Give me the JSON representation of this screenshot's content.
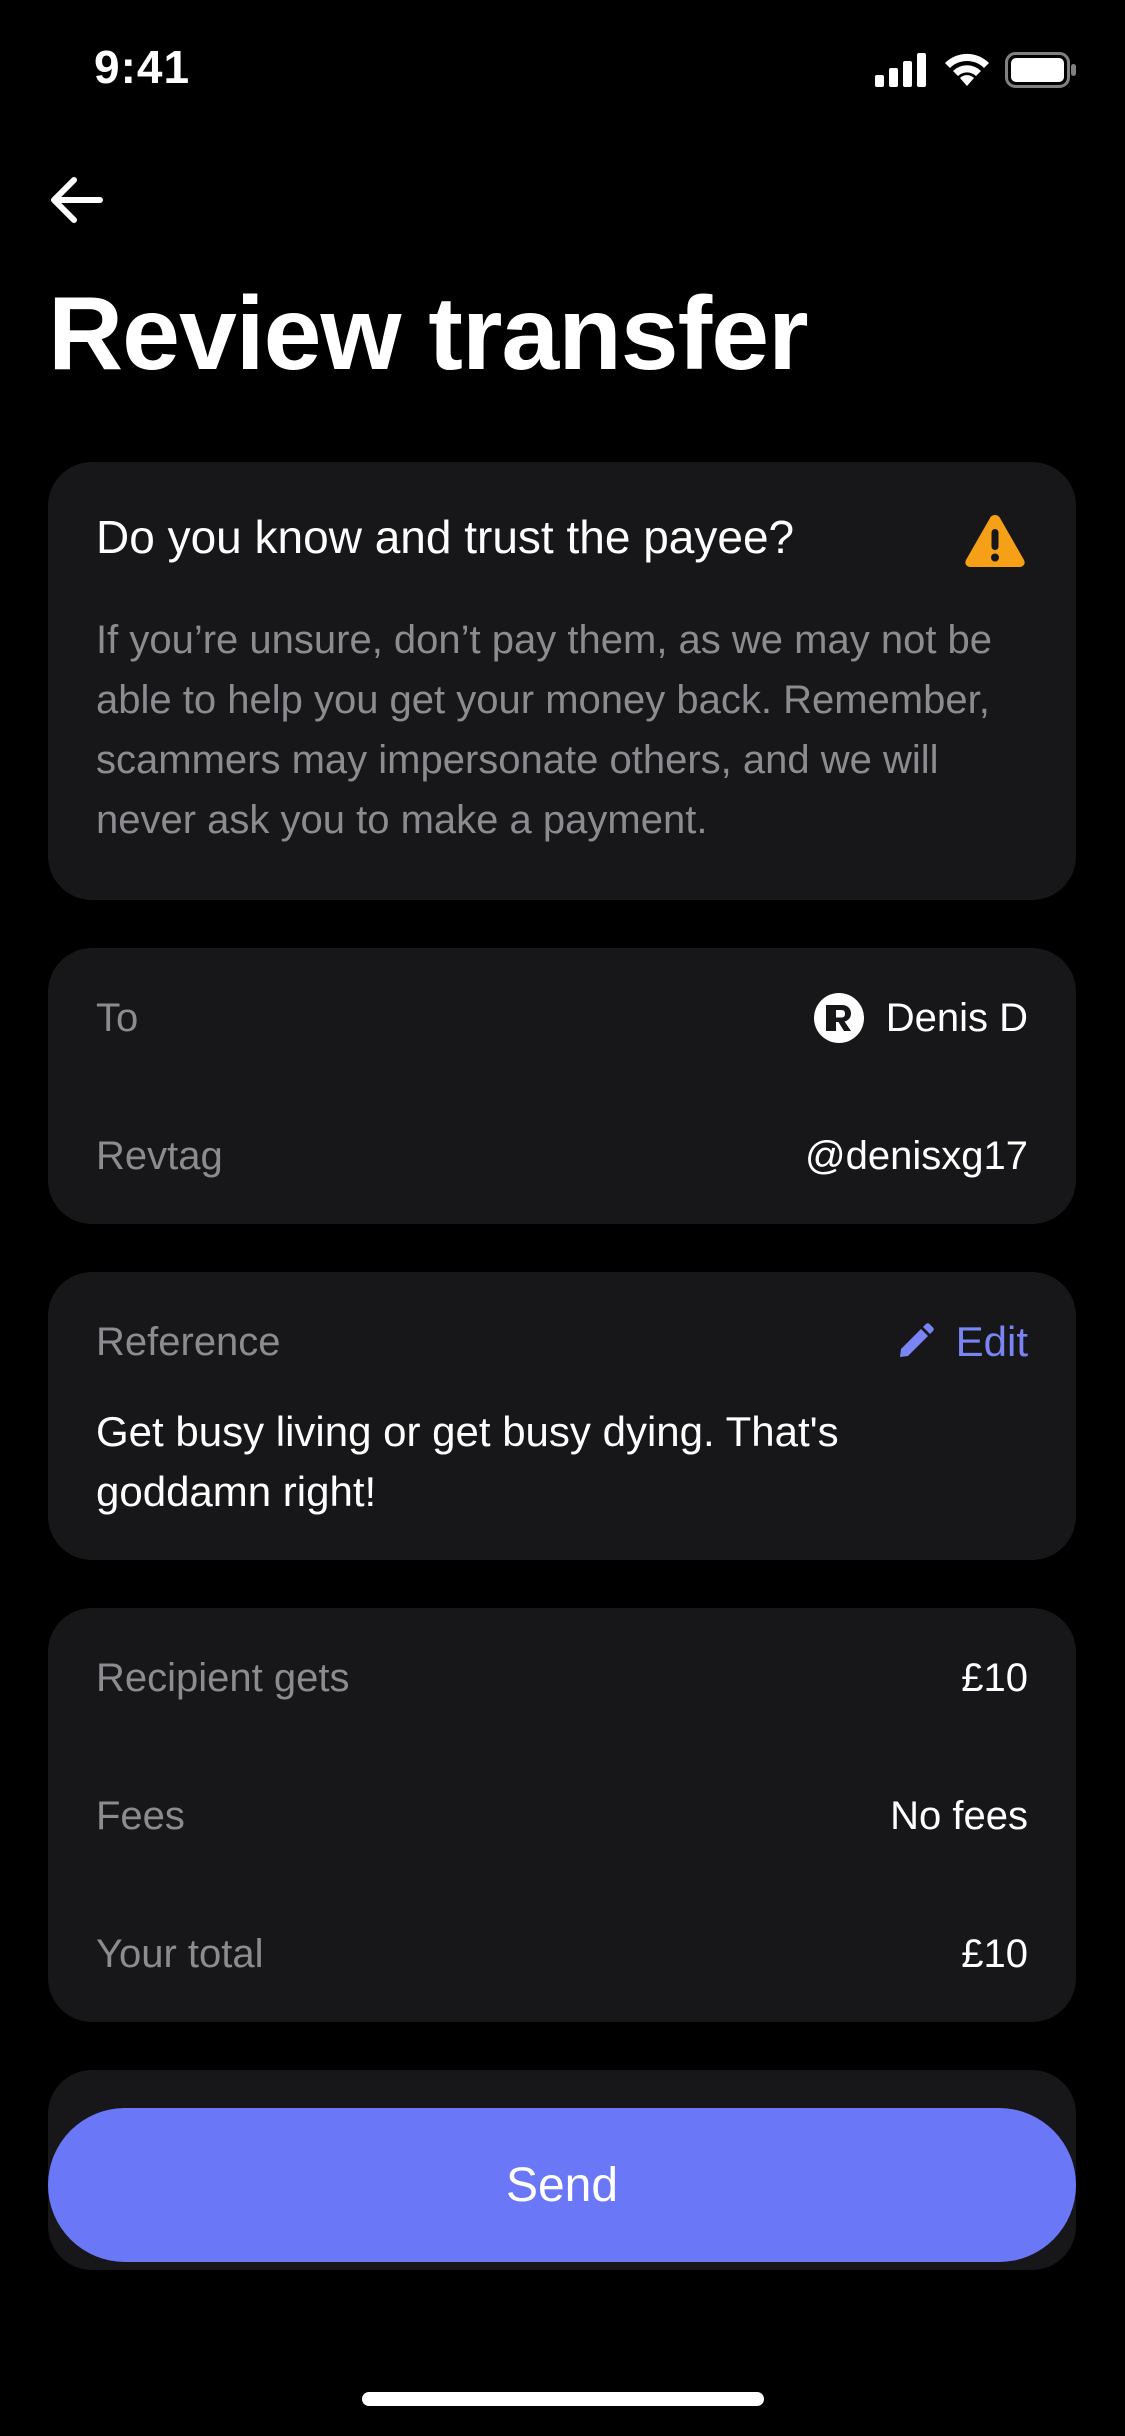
{
  "status_bar": {
    "time": "9:41"
  },
  "header": {
    "title": "Review transfer"
  },
  "warning": {
    "title": "Do you know and trust the payee?",
    "body": "If you’re unsure, don’t pay them, as we may not be able to help you get your money back. Remember, scammers may impersonate others, and we will never ask you to make a payment.",
    "icon": "warning-icon",
    "icon_color": "#f5a016"
  },
  "payee": {
    "to_label": "To",
    "to_value": "Denis D",
    "revtag_label": "Revtag",
    "revtag_value": "@denisxg17"
  },
  "reference": {
    "label": "Reference",
    "edit_label": "Edit",
    "text": "Get busy living or get busy dying. That's goddamn right!"
  },
  "summary": {
    "recipient_label": "Recipient gets",
    "recipient_value": "£10",
    "fees_label": "Fees",
    "fees_value": "No fees",
    "total_label": "Your total",
    "total_value": "£10"
  },
  "actions": {
    "send_label": "Send"
  },
  "colors": {
    "accent": "#6a78f8",
    "edit_accent": "#7b84f4",
    "card_background": "#171719",
    "page_background": "#000000"
  }
}
